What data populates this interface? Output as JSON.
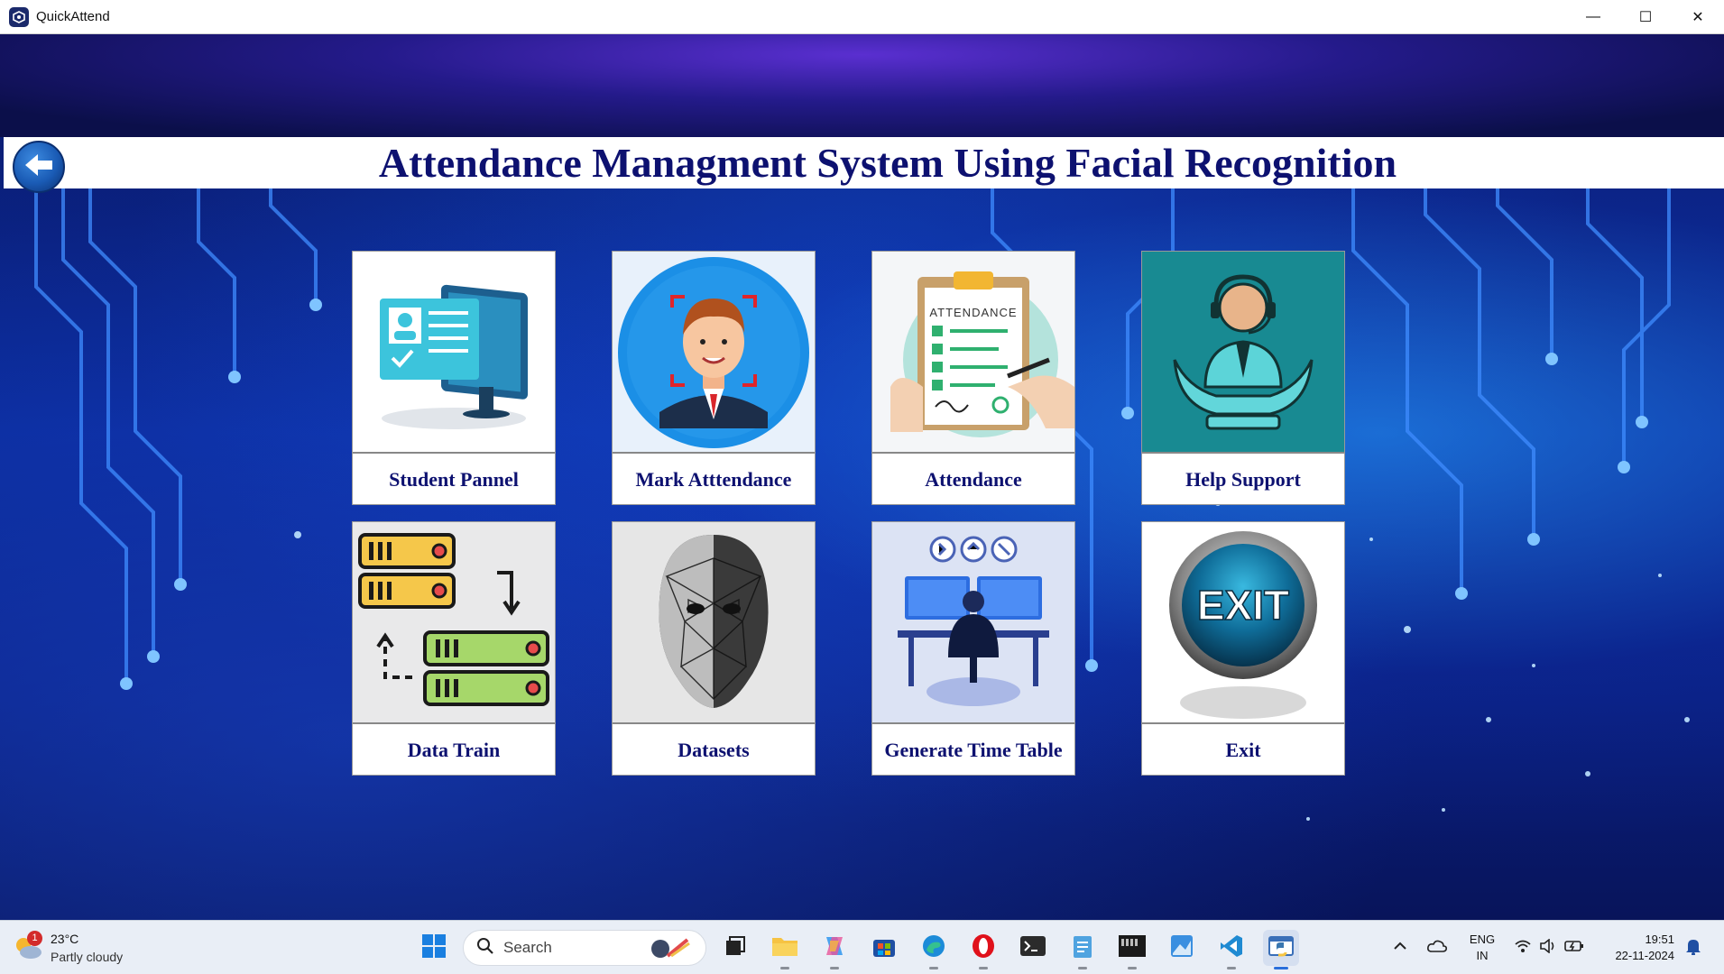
{
  "window": {
    "title": "QuickAttend",
    "controls": {
      "minimize": "—",
      "maximize": "☐",
      "close": "✕"
    }
  },
  "header": {
    "title": "Attendance Managment System Using Facial Recognition",
    "back_icon": "back-arrow-icon"
  },
  "tiles": [
    {
      "label": "Student Pannel",
      "icon": "student-monitor-icon"
    },
    {
      "label": "Mark Atttendance",
      "icon": "face-scan-icon"
    },
    {
      "label": "Attendance",
      "icon": "clipboard-checklist-icon"
    },
    {
      "label": "Help Support",
      "icon": "support-agent-icon"
    },
    {
      "label": "Data Train",
      "icon": "server-sync-icon"
    },
    {
      "label": "Datasets",
      "icon": "face-mesh-icon"
    },
    {
      "label": "Generate Time Table",
      "icon": "timetable-workstation-icon"
    },
    {
      "label": "Exit",
      "icon": "exit-button-icon",
      "badge_text": "EXIT"
    }
  ],
  "taskbar": {
    "weather": {
      "temp": "23°C",
      "condition": "Partly cloudy",
      "badge": "1"
    },
    "search_placeholder": "Search",
    "language": {
      "line1": "ENG",
      "line2": "IN"
    },
    "time": "19:51",
    "date": "22-11-2024"
  },
  "colors": {
    "title_text": "#0d1170",
    "background": "#0a1f80",
    "taskbar": "#e9eef6"
  }
}
